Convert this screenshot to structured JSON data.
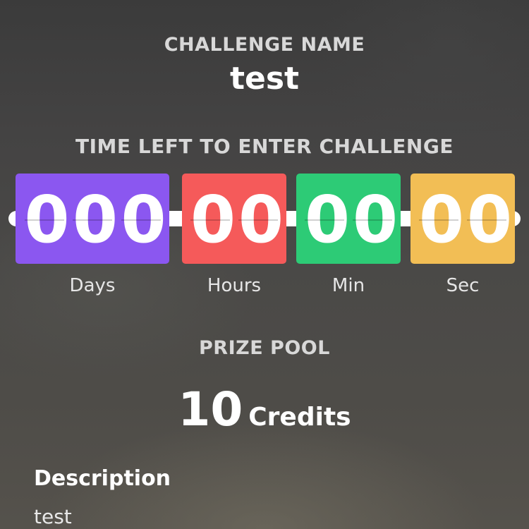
{
  "challenge": {
    "label": "CHALLENGE NAME",
    "name": "test"
  },
  "countdown": {
    "label": "TIME LEFT TO ENTER CHALLENGE",
    "units": [
      {
        "label": "Days",
        "digits": [
          "0",
          "0",
          "0"
        ],
        "color": "#8B57F0"
      },
      {
        "label": "Hours",
        "digits": [
          "0",
          "0"
        ],
        "color": "#F55A5A"
      },
      {
        "label": "Min",
        "digits": [
          "0",
          "0"
        ],
        "color": "#2DCB76"
      },
      {
        "label": "Sec",
        "digits": [
          "0",
          "0"
        ],
        "color": "#F2BE55"
      }
    ]
  },
  "prize_pool": {
    "label": "PRIZE POOL",
    "amount": "10",
    "unit": "Credits"
  },
  "description": {
    "label": "Description",
    "text": "test"
  }
}
